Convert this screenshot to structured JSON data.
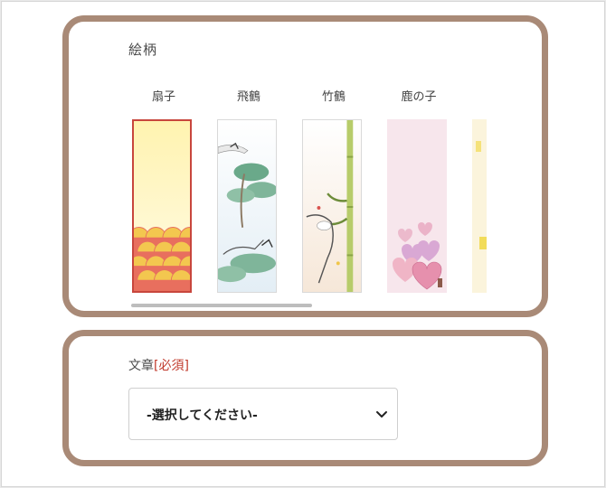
{
  "pattern_section": {
    "title": "絵柄",
    "items": [
      {
        "label": "扇子",
        "selected": true
      },
      {
        "label": "飛鶴",
        "selected": false
      },
      {
        "label": "竹鶴",
        "selected": false
      },
      {
        "label": "鹿の子",
        "selected": false
      },
      {
        "label": "",
        "selected": false
      }
    ]
  },
  "sentence_section": {
    "label": "文章",
    "required": "[必須]",
    "select_value": "-選択してください-"
  },
  "colors": {
    "card_border": "#a98a77",
    "selected_border": "#c8463d",
    "required_text": "#c0392b"
  }
}
